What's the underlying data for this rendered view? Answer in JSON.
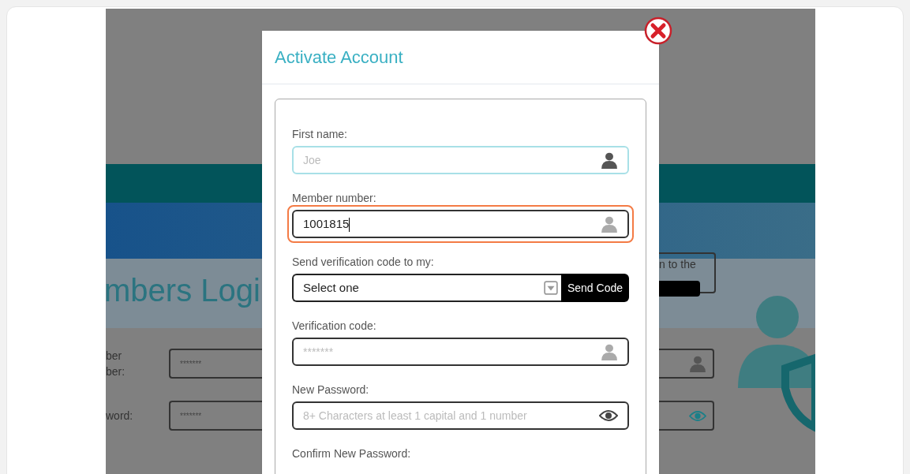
{
  "background_page": {
    "heading": "mbers Logi",
    "notice": {
      "text": "n to the"
    },
    "login_rows": [
      {
        "kind": "text",
        "label_lines": [
          "ber",
          "ber:"
        ],
        "placeholder": "*******"
      },
      {
        "kind": "password",
        "label_lines": [
          "word:"
        ],
        "placeholder": "*******"
      }
    ]
  },
  "modal": {
    "title": "Activate Account",
    "fields": [
      {
        "kind": "text",
        "label": "First name:",
        "placeholder": "Joe",
        "focused": true,
        "highlighted": false
      },
      {
        "kind": "text",
        "label": "Member number:",
        "value": "1001815",
        "focused": false,
        "highlighted": true
      },
      {
        "kind": "select",
        "label": "Send verification code to my:",
        "value": "Select one",
        "button": "Send Code",
        "focused": false,
        "highlighted": false
      },
      {
        "kind": "text",
        "label": "Verification code:",
        "placeholder": "*******",
        "focused": false,
        "highlighted": false
      },
      {
        "kind": "password",
        "label": "New Password:",
        "placeholder": "8+ Characters at least 1 capital and 1 number",
        "focused": false,
        "highlighted": false
      },
      {
        "kind": "label",
        "label": "Confirm New Password:"
      }
    ]
  }
}
